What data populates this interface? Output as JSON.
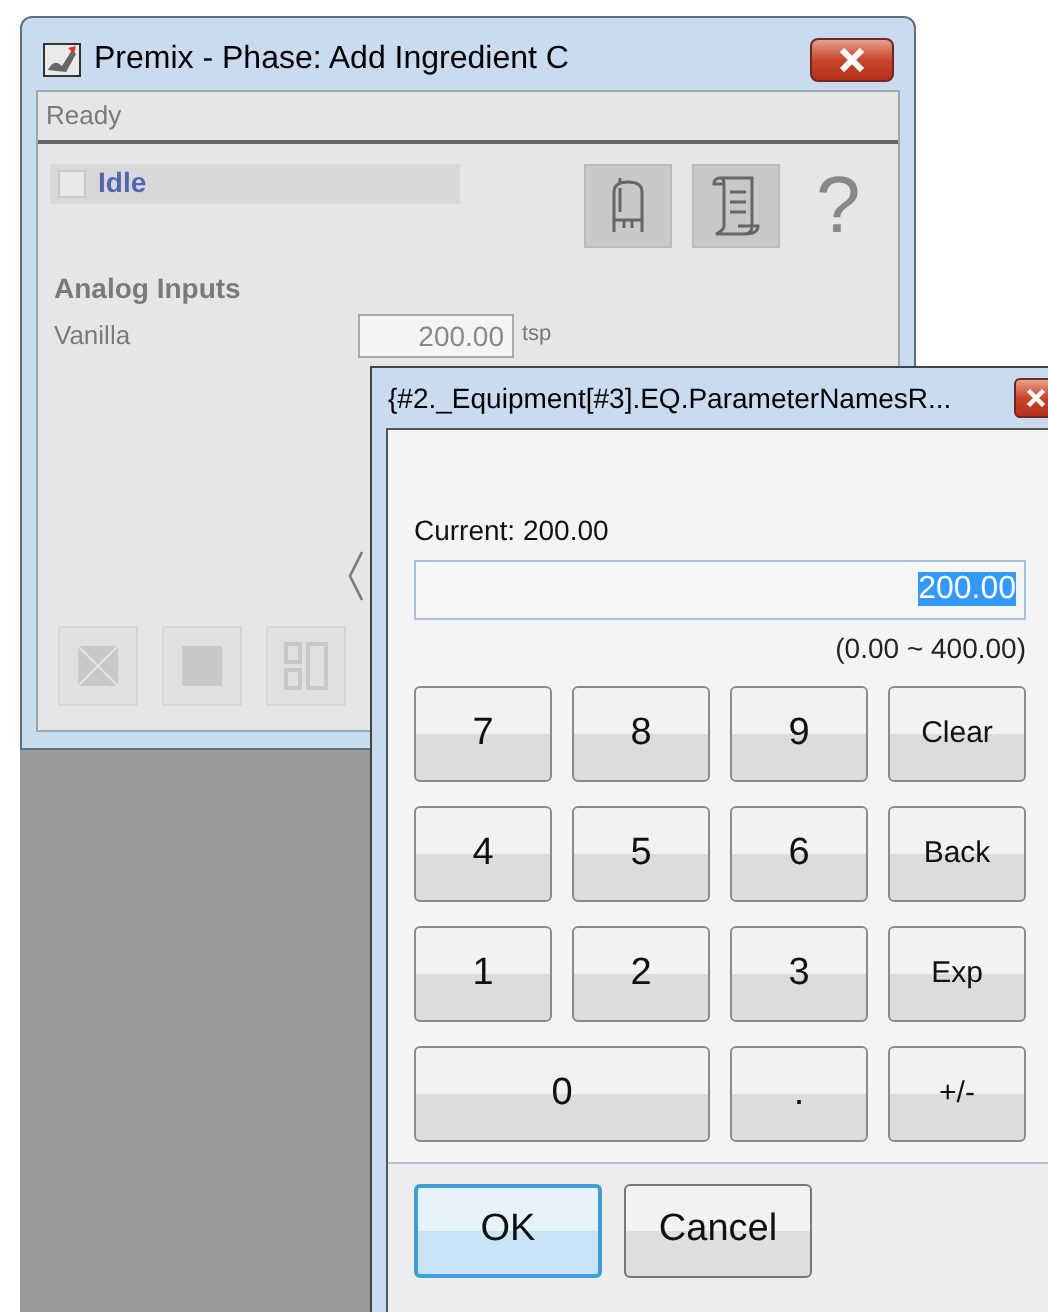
{
  "main_window": {
    "title": "Premix - Phase: Add Ingredient C",
    "status": "Ready",
    "phase": {
      "label": "Idle",
      "checked": false
    },
    "help": "?",
    "section": "Analog Inputs",
    "inputs": [
      {
        "label": "Vanilla",
        "value": "200.00",
        "unit": "tsp"
      }
    ],
    "bottom_buttons": [
      {
        "kind": "abort",
        "disabled": true
      },
      {
        "kind": "stop",
        "disabled": true
      },
      {
        "kind": "hold",
        "disabled": true
      }
    ]
  },
  "dialog": {
    "title": "{#2._Equipment[#3].EQ.ParameterNamesR...",
    "current": "Current: 200.00",
    "value": "200.00",
    "range": "(0.00 ~ 400.00)",
    "keys": [
      {
        "label": "7",
        "kind": "digit"
      },
      {
        "label": "8",
        "kind": "digit"
      },
      {
        "label": "9",
        "kind": "digit"
      },
      {
        "label": "Clear",
        "kind": "command"
      },
      {
        "label": "4",
        "kind": "digit"
      },
      {
        "label": "5",
        "kind": "digit"
      },
      {
        "label": "6",
        "kind": "digit"
      },
      {
        "label": "Back",
        "kind": "command"
      },
      {
        "label": "1",
        "kind": "digit"
      },
      {
        "label": "2",
        "kind": "digit"
      },
      {
        "label": "3",
        "kind": "digit"
      },
      {
        "label": "Exp",
        "kind": "command"
      },
      {
        "label": "0",
        "kind": "wide"
      },
      {
        "label": ".",
        "kind": "digit"
      },
      {
        "label": "+/-",
        "kind": "command"
      }
    ],
    "buttons": [
      {
        "label": "OK",
        "focused": true
      },
      {
        "label": "Cancel",
        "focused": false
      }
    ]
  }
}
